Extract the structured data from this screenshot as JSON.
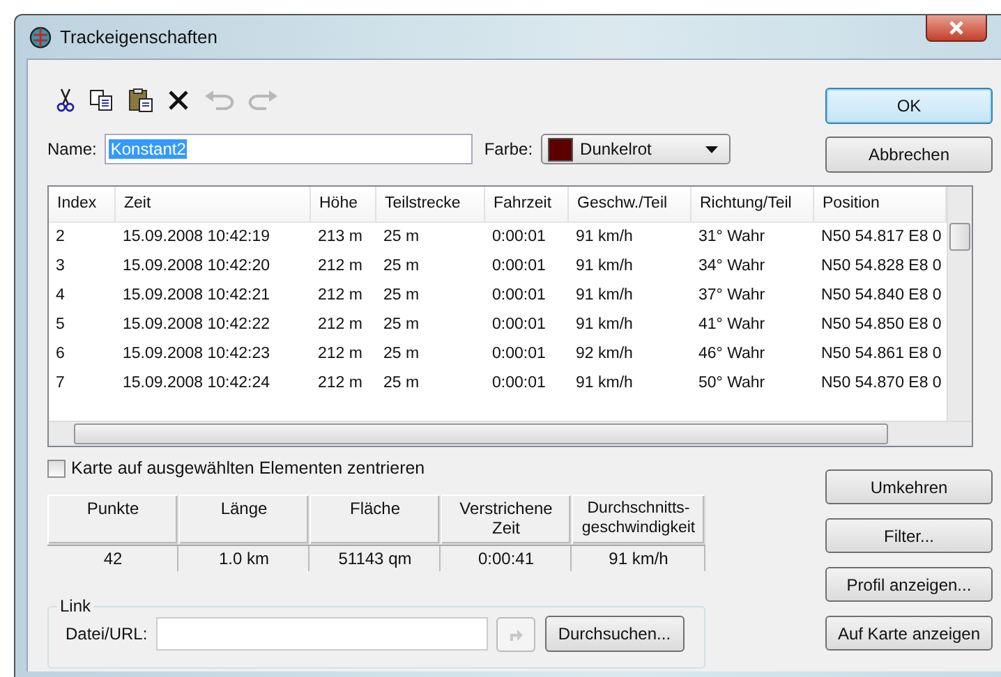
{
  "window": {
    "title": "Trackeigenschaften"
  },
  "toolbar": [
    {
      "kind": "cut",
      "disabled": false
    },
    {
      "kind": "copy",
      "disabled": false
    },
    {
      "kind": "paste",
      "disabled": false
    },
    {
      "kind": "delete",
      "disabled": false
    },
    {
      "kind": "undo",
      "disabled": true
    },
    {
      "kind": "redo",
      "disabled": true
    }
  ],
  "name": {
    "label": "Name:",
    "value": "Konstant2"
  },
  "color": {
    "label": "Farbe:",
    "value": "Dunkelrot",
    "color": "#5c0000"
  },
  "dialog_buttons": [
    "OK",
    "Abbrechen"
  ],
  "table": {
    "columns": [
      "Index",
      "Zeit",
      "Höhe",
      "Teilstrecke",
      "Fahrzeit",
      "Geschw./Teil",
      "Richtung/Teil",
      "Position"
    ],
    "rows": [
      [
        "2",
        "15.09.2008 10:42:19",
        "213 m",
        "25 m",
        "0:00:01",
        "91 km/h",
        "31° Wahr",
        "N50 54.817 E8 0"
      ],
      [
        "3",
        "15.09.2008 10:42:20",
        "212 m",
        "25 m",
        "0:00:01",
        "91 km/h",
        "34° Wahr",
        "N50 54.828 E8 0"
      ],
      [
        "4",
        "15.09.2008 10:42:21",
        "212 m",
        "25 m",
        "0:00:01",
        "91 km/h",
        "37° Wahr",
        "N50 54.840 E8 0"
      ],
      [
        "5",
        "15.09.2008 10:42:22",
        "212 m",
        "25 m",
        "0:00:01",
        "91 km/h",
        "41° Wahr",
        "N50 54.850 E8 0"
      ],
      [
        "6",
        "15.09.2008 10:42:23",
        "212 m",
        "25 m",
        "0:00:01",
        "92 km/h",
        "46° Wahr",
        "N50 54.861 E8 0"
      ],
      [
        "7",
        "15.09.2008 10:42:24",
        "212 m",
        "25 m",
        "0:00:01",
        "91 km/h",
        "50° Wahr",
        "N50 54.870 E8 0"
      ]
    ]
  },
  "center_checkbox": {
    "label": "Karte auf ausgewählten Elementen zentrieren",
    "checked": false
  },
  "summary": {
    "columns": [
      "Punkte",
      "Länge",
      "Fläche",
      "Verstrichene Zeit",
      "Durchschnitts-geschwindigkeit"
    ],
    "values": [
      "42",
      "1.0 km",
      "51143 qm",
      "0:00:41",
      "91 km/h"
    ]
  },
  "link": {
    "title": "Link",
    "label": "Datei/URL:",
    "go_disabled": true,
    "browse": "Durchsuchen..."
  },
  "side_buttons": [
    "Umkehren",
    "Filter...",
    "Profil anzeigen...",
    "Auf Karte anzeigen"
  ]
}
